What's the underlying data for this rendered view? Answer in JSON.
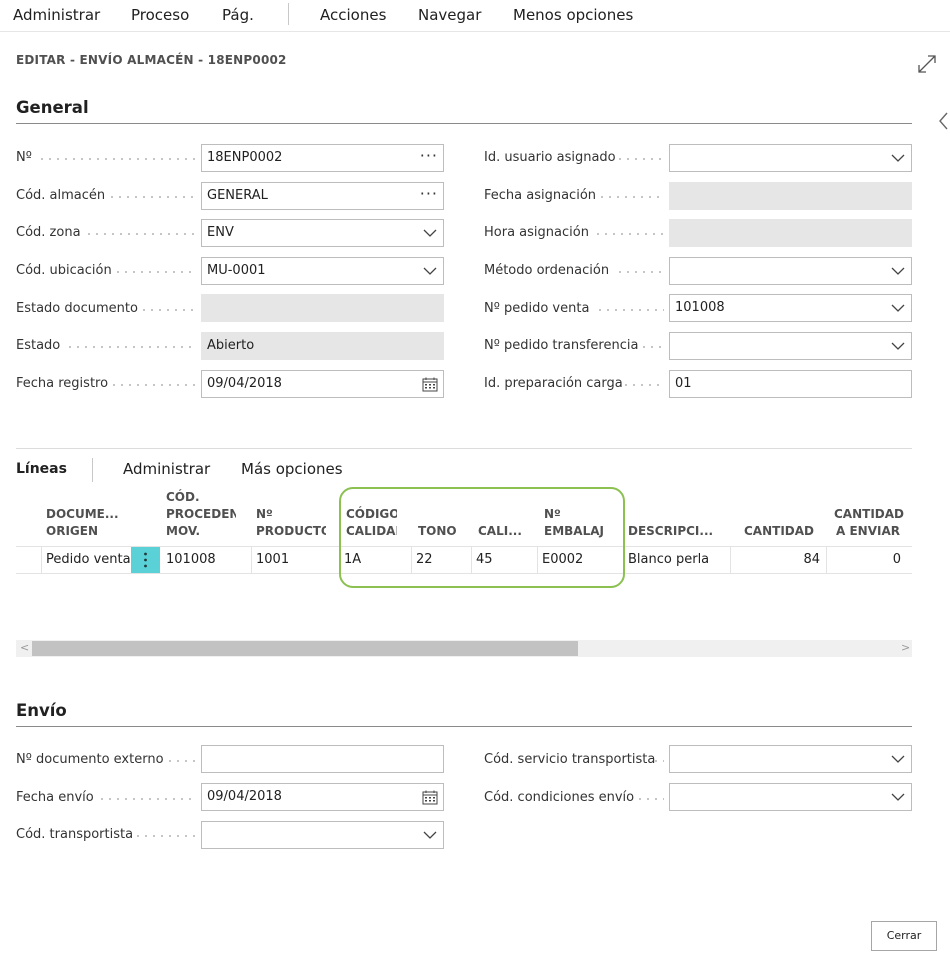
{
  "menu": [
    "Administrar",
    "Proceso",
    "Pág.",
    "Acciones",
    "Navegar",
    "Menos opciones"
  ],
  "page_title": "EDITAR - ENVÍO ALMACÉN - 18ENP0002",
  "general": {
    "title": "General",
    "left": [
      {
        "label": "Nº",
        "value": "18ENP0002",
        "control": "ellipsis"
      },
      {
        "label": "Cód. almacén",
        "value": "GENERAL",
        "control": "ellipsis"
      },
      {
        "label": "Cód. zona",
        "value": "ENV",
        "control": "dropdown"
      },
      {
        "label": "Cód. ubicación",
        "value": "MU-0001",
        "control": "dropdown"
      },
      {
        "label": "Estado documento",
        "value": "",
        "control": "readonly"
      },
      {
        "label": "Estado",
        "value": "Abierto",
        "control": "readonly"
      },
      {
        "label": "Fecha registro",
        "value": "09/04/2018",
        "control": "date"
      }
    ],
    "right": [
      {
        "label": "Id. usuario asignado",
        "value": "",
        "control": "dropdown"
      },
      {
        "label": "Fecha asignación",
        "value": "",
        "control": "readonly"
      },
      {
        "label": "Hora asignación",
        "value": "",
        "control": "readonly"
      },
      {
        "label": "Método ordenación",
        "value": "",
        "control": "dropdown"
      },
      {
        "label": "Nº pedido venta",
        "value": "101008",
        "control": "dropdown"
      },
      {
        "label": "Nº pedido transferencia",
        "value": "",
        "control": "dropdown"
      },
      {
        "label": "Id. preparación carga",
        "value": "01",
        "control": "text"
      }
    ]
  },
  "lines": {
    "tabs": [
      "Líneas",
      "Administrar",
      "Más opciones"
    ],
    "columns": [
      {
        "line1": "DOCUME...",
        "line2": "ORIGEN"
      },
      {
        "line1": "CÓD.",
        "line2": "PROCEDEN",
        "line3": "MOV."
      },
      {
        "line1": "Nº",
        "line2": "PRODUCTO"
      },
      {
        "line1": "CÓDIGO",
        "line2": "CALIDAD"
      },
      {
        "line1": "",
        "line2": "TONO"
      },
      {
        "line1": "",
        "line2": "CALI..."
      },
      {
        "line1": "Nº",
        "line2": "EMBALAJ"
      },
      {
        "line1": "",
        "line2": "DESCRIPCI..."
      },
      {
        "line1": "",
        "line2": "CANTIDAD"
      },
      {
        "line1": "CANTIDAD",
        "line2": "A ENVIAR"
      }
    ],
    "rows": [
      {
        "documento_origen": "Pedido venta",
        "cod_procedencia": "101008",
        "producto": "1001",
        "calidad": "1A",
        "tono": "22",
        "calibre": "45",
        "embalaje": "E0002",
        "descripcion": "Blanco perla",
        "cantidad": "84",
        "cantidad_enviar": "0"
      }
    ],
    "scroll_visible_fraction": 0.61
  },
  "envio": {
    "title": "Envío",
    "left": [
      {
        "label": "Nº documento externo",
        "value": "",
        "control": "text"
      },
      {
        "label": "Fecha envío",
        "value": "09/04/2018",
        "control": "date"
      },
      {
        "label": "Cód. transportista",
        "value": "",
        "control": "dropdown"
      }
    ],
    "right": [
      {
        "label": "Cód. servicio transportista",
        "value": "",
        "control": "dropdown"
      },
      {
        "label": "Cód. condiciones envío",
        "value": "",
        "control": "dropdown"
      }
    ]
  },
  "close_label": "Cerrar",
  "colors": {
    "highlight": "#8cc152",
    "row_menu": "#5ad1d6",
    "readonly": "#e6e6e6"
  }
}
